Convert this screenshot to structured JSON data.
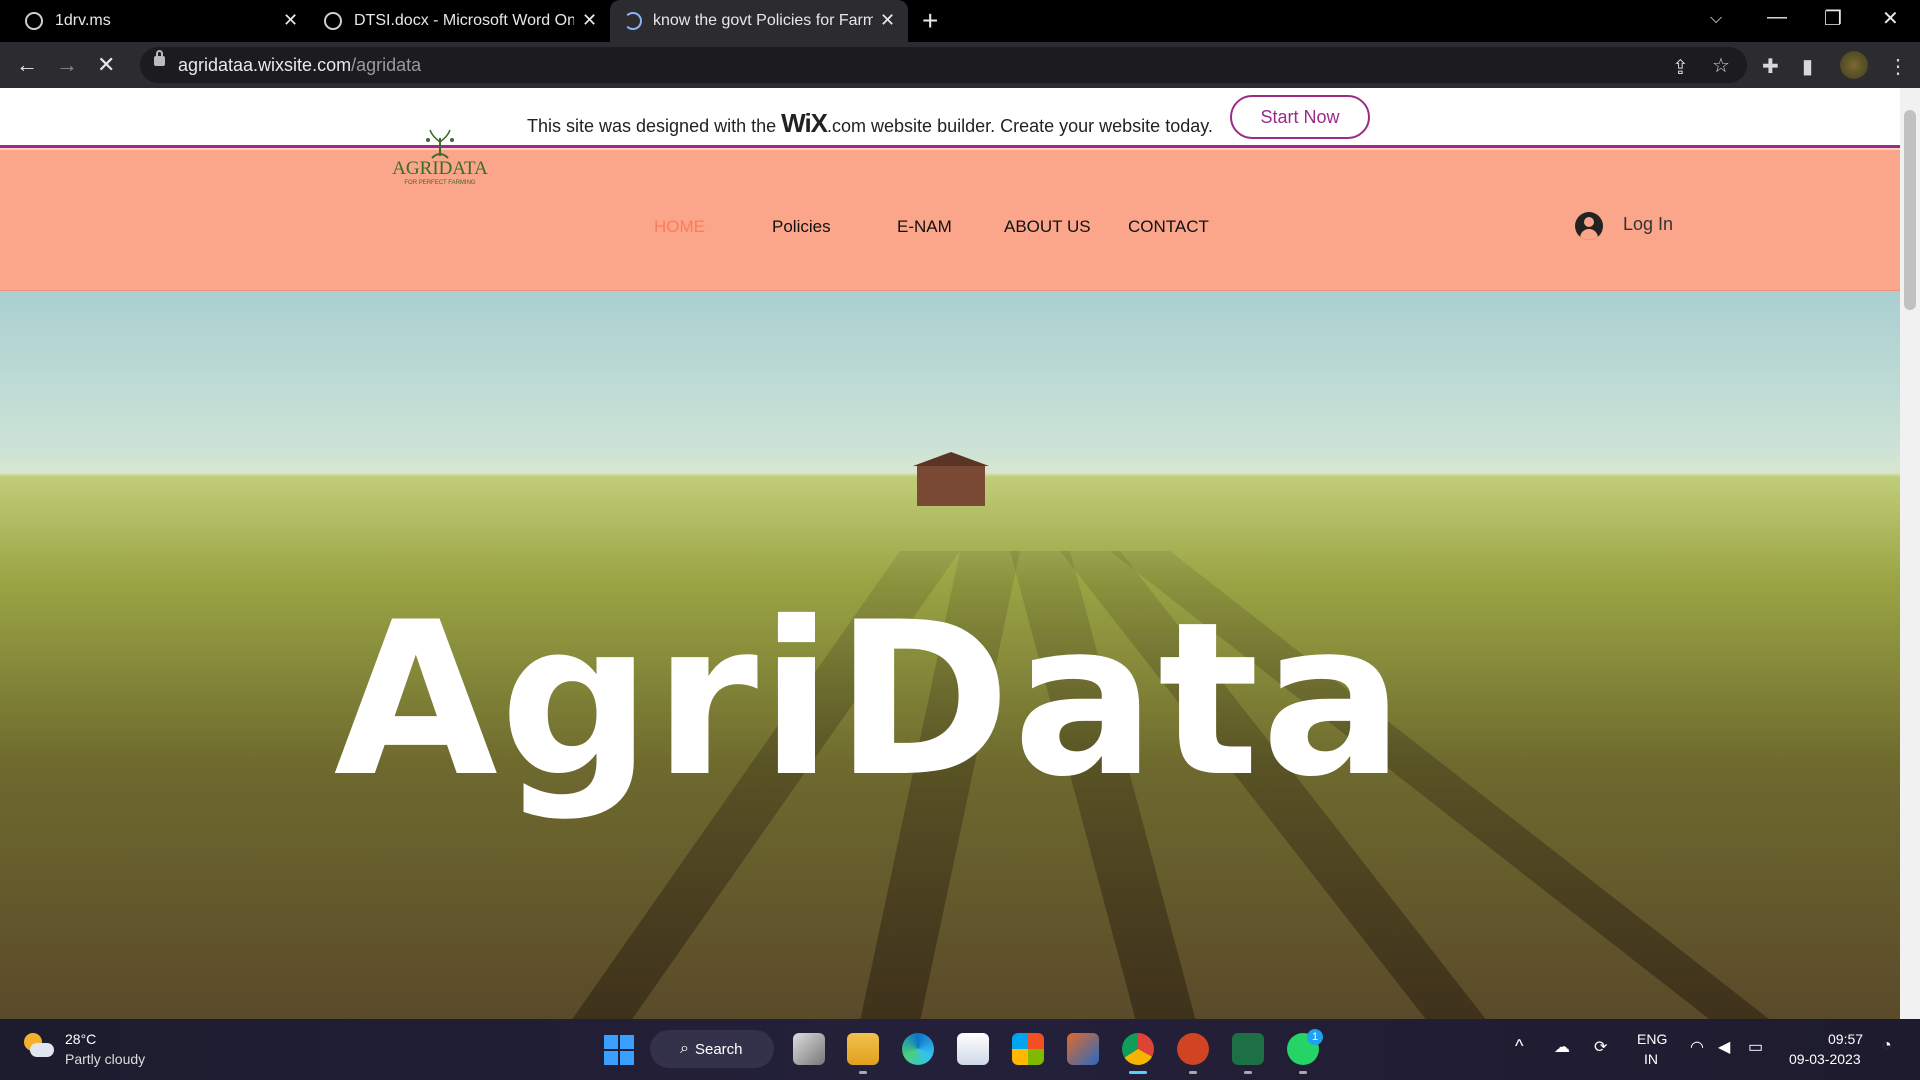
{
  "browser": {
    "tabs": [
      {
        "label": "1drv.ms"
      },
      {
        "label": "DTSI.docx - Microsoft Word Online"
      },
      {
        "label": "know the govt Policies for Farmers"
      }
    ],
    "new_tab": "+",
    "url_host": "agridataa.wixsite.com",
    "url_path": "/agridata"
  },
  "wix_banner": {
    "text_before": "This site was designed with the ",
    "brand": "WiX",
    "text_after": ".com website builder. Create your website today.",
    "start_button": "Start Now",
    "accent": "#9b2a88"
  },
  "site": {
    "logo_name": "AGRIDATA",
    "logo_tagline": "FOR PERFECT FARMING",
    "nav": [
      {
        "label": "HOME",
        "active": true
      },
      {
        "label": "Policies"
      },
      {
        "label": "E-NAM"
      },
      {
        "label": "ABOUT US"
      },
      {
        "label": "CONTACT"
      }
    ],
    "login_label": "Log In",
    "header_color": "#fba58b",
    "hero_title": "AgriData"
  },
  "taskbar": {
    "weather_temp": "28°C",
    "weather_desc": "Partly cloudy",
    "search_label": "Search",
    "whatsapp_badge": "1",
    "lang_line1": "ENG",
    "lang_line2": "IN",
    "time": "09:57",
    "date": "09-03-2023"
  }
}
